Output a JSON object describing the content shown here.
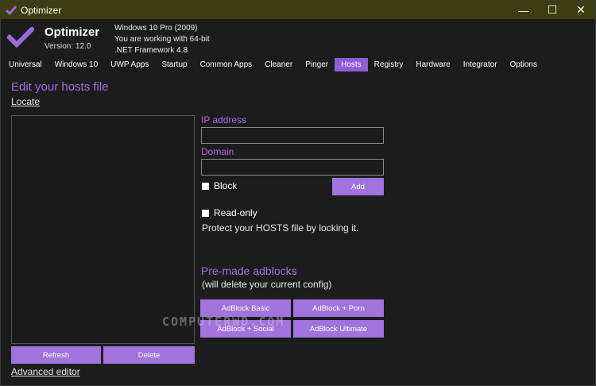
{
  "window": {
    "title": "Optimizer",
    "controls": {
      "minimize": "—",
      "maximize": "☐",
      "close": "✕"
    }
  },
  "header": {
    "app_name": "Optimizer",
    "version": "Version: 12.0",
    "os": "Windows 10 Pro (2009)",
    "arch": "You are working with 64-bit",
    "framework": ".NET Framework 4.8",
    "accent_color": "#8f5bd6",
    "titlebar_color": "#3d3d0f"
  },
  "tabs": [
    {
      "label": "Universal",
      "active": false
    },
    {
      "label": "Windows 10",
      "active": false
    },
    {
      "label": "UWP Apps",
      "active": false
    },
    {
      "label": "Startup",
      "active": false
    },
    {
      "label": "Common Apps",
      "active": false
    },
    {
      "label": "Cleaner",
      "active": false
    },
    {
      "label": "Pinger",
      "active": false
    },
    {
      "label": "Hosts",
      "active": true
    },
    {
      "label": "Registry",
      "active": false
    },
    {
      "label": "Hardware",
      "active": false
    },
    {
      "label": "Integrator",
      "active": false
    },
    {
      "label": "Options",
      "active": false
    }
  ],
  "hosts": {
    "title": "Edit your hosts file",
    "locate_link": "Locate",
    "refresh_button": "Refresh",
    "delete_button": "Delete",
    "advanced_editor_link": "Advanced editor",
    "ip_label": "IP address",
    "ip_value": "",
    "domain_label": "Domain",
    "domain_value": "",
    "block_label": "Block",
    "block_checked": false,
    "add_button": "Add",
    "readonly_label": "Read-only",
    "readonly_checked": false,
    "readonly_info": "Protect your HOSTS file by locking it."
  },
  "adblocks": {
    "title": "Pre-made adblocks",
    "subtitle": "(will delete your current config)",
    "basic": "AdBlock Basic",
    "porn": "AdBlock + Porn",
    "social": "AdBlock + Social",
    "ultimate": "AdBlock Ultimate"
  },
  "watermark": "COMPUTERWD.COM"
}
